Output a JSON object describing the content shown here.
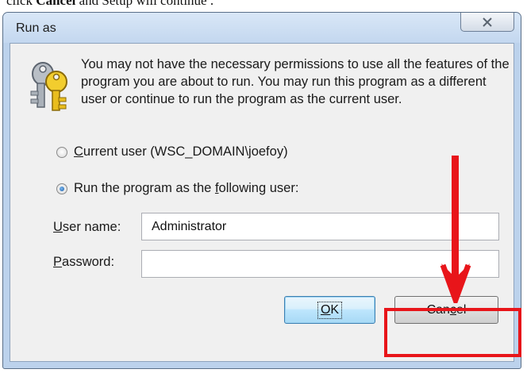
{
  "caption": {
    "pre": "click ",
    "bold": "Cancel",
    "post": " and Setup will continue ."
  },
  "window": {
    "title": "Run as",
    "close_icon": "close-x-icon"
  },
  "message": "You may not have the necessary permissions to use all the features of the program you are about to run. You may run this program as a different user or continue to run the program as the current user.",
  "radio_current": {
    "mnemonic": "C",
    "rest": "urrent user (WSC_DOMAIN\\joefoy)",
    "checked": false
  },
  "radio_other": {
    "pre": "Run the program as the ",
    "mnemonic": "f",
    "post": "ollowing user:",
    "checked": true
  },
  "username": {
    "mnemonic": "U",
    "rest": "ser name:",
    "value": "Administrator"
  },
  "password": {
    "mnemonic": "P",
    "rest": "assword:",
    "value": ""
  },
  "buttons": {
    "ok": {
      "mnemonic": "O",
      "rest": "K"
    },
    "cancel": {
      "pre": "Can",
      "mnemonic": "c",
      "post": "el"
    }
  },
  "annotation": {
    "color": "#e8151a",
    "icons": [
      "down-arrow-icon",
      "highlight-box"
    ]
  },
  "icons": {
    "app": "keys-icon"
  }
}
